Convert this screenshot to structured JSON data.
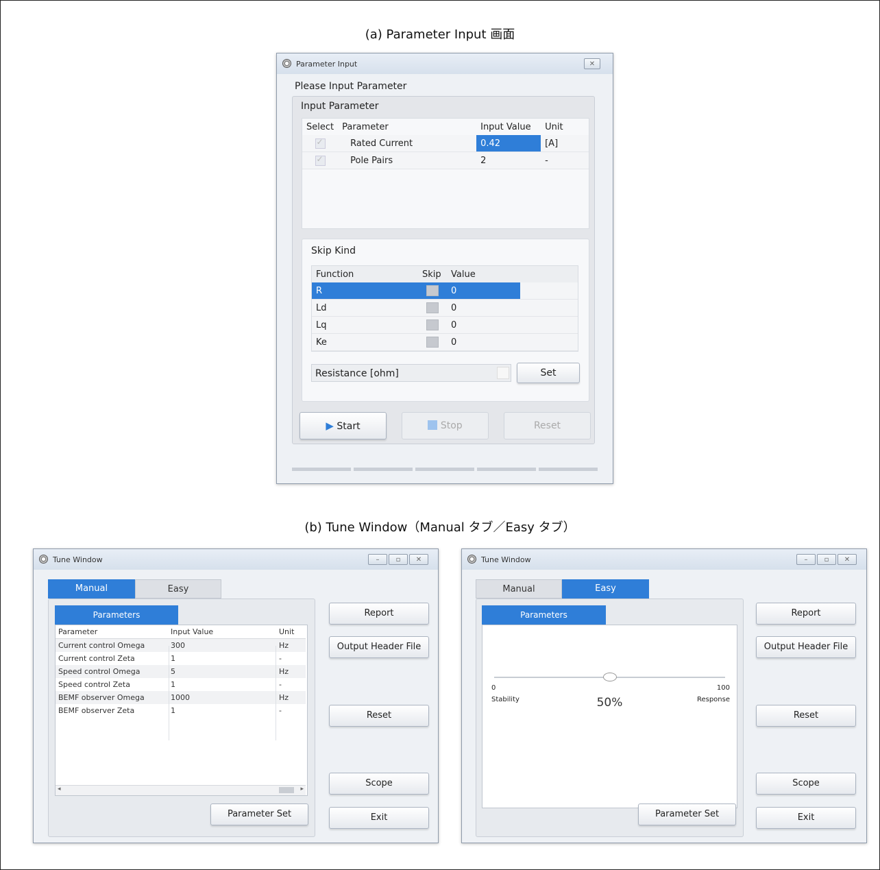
{
  "captions": {
    "a": "(a) Parameter Input 画面",
    "b": "(b) Tune Window（Manual タブ／Easy タブ）"
  },
  "param_input": {
    "title": "Parameter Input",
    "close_glyph": "✕",
    "prompt": "Please Input Parameter",
    "input_section_title": "Input Parameter",
    "columns": [
      "Select",
      "Parameter",
      "Input Value",
      "Unit"
    ],
    "rows": [
      {
        "parameter": "Rated Current",
        "value": "0.42",
        "unit": "[A]"
      },
      {
        "parameter": "Pole Pairs",
        "value": "2",
        "unit": "-"
      }
    ],
    "skip_section_title": "Skip Kind",
    "skip_columns": [
      "Function",
      "Skip",
      "Value"
    ],
    "skip_rows": [
      {
        "function": "R",
        "value": "0"
      },
      {
        "function": "Ld",
        "value": "0"
      },
      {
        "function": "Lq",
        "value": "0"
      },
      {
        "function": "Ke",
        "value": "0"
      }
    ],
    "resistance_field": "Resistance [ohm]",
    "set_label": "Set",
    "start_label": "Start",
    "stop_label": "Stop",
    "reset_label": "Reset"
  },
  "tune_manual": {
    "title": "Tune Window",
    "tab_manual": "Manual",
    "tab_easy": "Easy",
    "subtab": "Parameters",
    "grid_headers": [
      "Parameter",
      "Input Value",
      "Unit"
    ],
    "grid_rows": [
      {
        "parameter": "Current control Omega",
        "value": "300",
        "unit": "Hz"
      },
      {
        "parameter": "Current control Zeta",
        "value": "1",
        "unit": "-"
      },
      {
        "parameter": "Speed control Omega",
        "value": "5",
        "unit": "Hz"
      },
      {
        "parameter": "Speed control Zeta",
        "value": "1",
        "unit": "-"
      },
      {
        "parameter": "BEMF observer Omega",
        "value": "1000",
        "unit": "Hz"
      },
      {
        "parameter": "BEMF observer Zeta",
        "value": "1",
        "unit": "-"
      }
    ],
    "param_set_label": "Parameter Set",
    "side_buttons": {
      "report": "Report",
      "output": "Output Header File",
      "reset": "Reset",
      "scope": "Scope",
      "exit": "Exit"
    }
  },
  "tune_easy": {
    "title": "Tune Window",
    "tab_manual": "Manual",
    "tab_easy": "Easy",
    "subtab": "Parameters",
    "slider_min": "0",
    "slider_max": "100",
    "left_label": "Stability",
    "right_label": "Response",
    "percent": "50%",
    "slider_level": 0.5,
    "param_set_label": "Parameter Set",
    "side_buttons": {
      "report": "Report",
      "output": "Output Header File",
      "reset": "Reset",
      "scope": "Scope",
      "exit": "Exit"
    }
  },
  "colors": {
    "accent": "#2f7ed8",
    "window_bg": "#eef1f5"
  }
}
